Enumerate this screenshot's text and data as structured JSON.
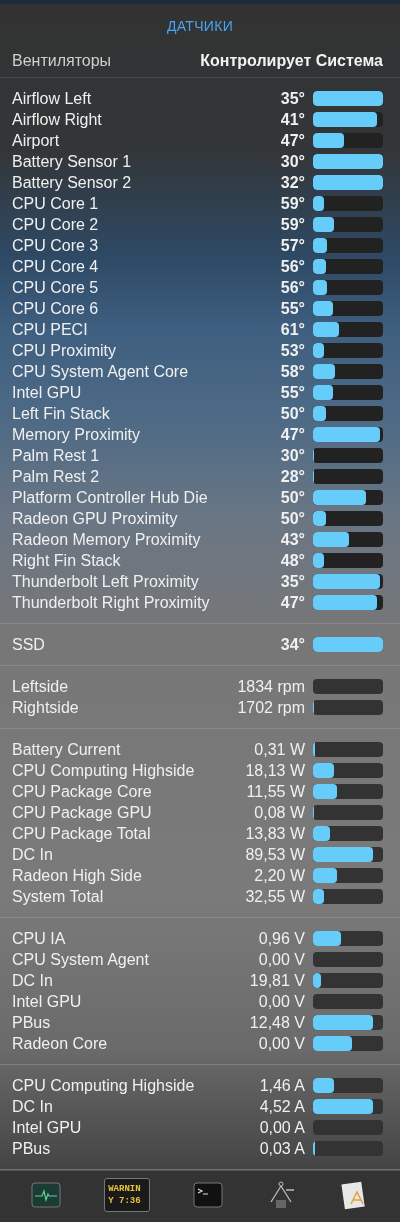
{
  "title": "ДАТЧИКИ",
  "fans_control": {
    "label": "Вентиляторы",
    "value": "Контролирует Система"
  },
  "sections": [
    {
      "rows": [
        {
          "name": "Airflow Left",
          "value": "35°",
          "level": 1.0
        },
        {
          "name": "Airflow Right",
          "value": "41°",
          "level": 0.92
        },
        {
          "name": "Airport",
          "value": "47°",
          "level": 0.44
        },
        {
          "name": "Battery Sensor 1",
          "value": "30°",
          "level": 1.0
        },
        {
          "name": "Battery Sensor 2",
          "value": "32°",
          "level": 1.0
        },
        {
          "name": "CPU Core 1",
          "value": "59°",
          "level": 0.16
        },
        {
          "name": "CPU Core 2",
          "value": "59°",
          "level": 0.3
        },
        {
          "name": "CPU Core 3",
          "value": "57°",
          "level": 0.2
        },
        {
          "name": "CPU Core 4",
          "value": "56°",
          "level": 0.18
        },
        {
          "name": "CPU Core 5",
          "value": "56°",
          "level": 0.2
        },
        {
          "name": "CPU Core 6",
          "value": "55°",
          "level": 0.28
        },
        {
          "name": "CPU PECI",
          "value": "61°",
          "level": 0.37
        },
        {
          "name": "CPU Proximity",
          "value": "53°",
          "level": 0.16
        },
        {
          "name": "CPU System Agent Core",
          "value": "58°",
          "level": 0.32
        },
        {
          "name": "Intel GPU",
          "value": "55°",
          "level": 0.28
        },
        {
          "name": "Left Fin Stack",
          "value": "50°",
          "level": 0.18
        },
        {
          "name": "Memory Proximity",
          "value": "47°",
          "level": 0.95
        },
        {
          "name": "Palm Rest 1",
          "value": "30°",
          "level": 0.01
        },
        {
          "name": "Palm Rest 2",
          "value": "28°",
          "level": 0.01
        },
        {
          "name": "Platform Controller Hub Die",
          "value": "50°",
          "level": 0.75
        },
        {
          "name": "Radeon GPU Proximity",
          "value": "50°",
          "level": 0.18
        },
        {
          "name": "Radeon Memory Proximity",
          "value": "43°",
          "level": 0.52
        },
        {
          "name": "Right Fin Stack",
          "value": "48°",
          "level": 0.15
        },
        {
          "name": "Thunderbolt Left Proximity",
          "value": "35°",
          "level": 0.95
        },
        {
          "name": "Thunderbolt Right Proximity",
          "value": "47°",
          "level": 0.92
        }
      ]
    },
    {
      "rows": [
        {
          "name": "SSD",
          "value": "34°",
          "level": 1.0
        }
      ]
    },
    {
      "rows": [
        {
          "name": "Leftside",
          "value": "1834 rpm",
          "level": 0.0
        },
        {
          "name": "Rightside",
          "value": "1702 rpm",
          "level": 0.02
        }
      ]
    },
    {
      "rows": [
        {
          "name": "Battery Current",
          "value": "0,31 W",
          "level": 0.03
        },
        {
          "name": "CPU Computing Highside",
          "value": "18,13 W",
          "level": 0.3
        },
        {
          "name": "CPU Package Core",
          "value": "11,55 W",
          "level": 0.34
        },
        {
          "name": "CPU Package GPU",
          "value": "0,08 W",
          "level": 0.02
        },
        {
          "name": "CPU Package Total",
          "value": "13,83 W",
          "level": 0.24
        },
        {
          "name": "DC In",
          "value": "89,53 W",
          "level": 0.86
        },
        {
          "name": "Radeon High Side",
          "value": "2,20 W",
          "level": 0.34
        },
        {
          "name": "System Total",
          "value": "32,55 W",
          "level": 0.15
        }
      ]
    },
    {
      "rows": [
        {
          "name": "CPU IA",
          "value": "0,96 V",
          "level": 0.4
        },
        {
          "name": "CPU System Agent",
          "value": "0,00 V",
          "level": 0.0
        },
        {
          "name": "DC In",
          "value": "19,81 V",
          "level": 0.12
        },
        {
          "name": "Intel GPU",
          "value": "0,00 V",
          "level": 0.0
        },
        {
          "name": "PBus",
          "value": "12,48 V",
          "level": 0.85
        },
        {
          "name": "Radeon Core",
          "value": "0,00 V",
          "level": 0.56
        }
      ]
    },
    {
      "rows": [
        {
          "name": "CPU Computing Highside",
          "value": "1,46 A",
          "level": 0.3
        },
        {
          "name": "DC In",
          "value": "4,52 A",
          "level": 0.86
        },
        {
          "name": "Intel GPU",
          "value": "0,00 A",
          "level": 0.0
        },
        {
          "name": "PBus",
          "value": "0,03 A",
          "level": 0.03
        }
      ]
    }
  ],
  "toolbar": [
    {
      "kind": "monitor"
    },
    {
      "kind": "console",
      "lines": [
        "WARNIN",
        "Y 7:36"
      ]
    },
    {
      "kind": "terminal"
    },
    {
      "kind": "caliper"
    },
    {
      "kind": "appdoc"
    }
  ]
}
